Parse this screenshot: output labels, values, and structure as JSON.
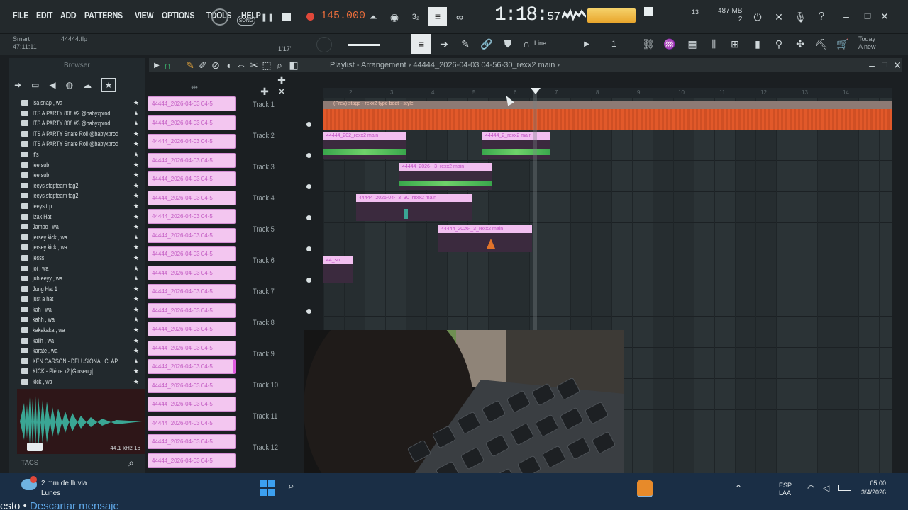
{
  "menu": [
    "FILE",
    "EDIT",
    "ADD",
    "PATTERNS",
    "VIEW",
    "OPTIONS",
    "TOOLS",
    "HELP"
  ],
  "hint": {
    "line1": "Smart",
    "line2": "47:11:11",
    "file": "44444.flp"
  },
  "transport": {
    "tempo": "145.000",
    "song_time_main": "1:18:",
    "song_time_sub": "57"
  },
  "stats": {
    "mem_top": "487 MB",
    "mem_bottom": "2",
    "cpu": "13"
  },
  "toolbar2": {
    "pattern": "1'17'",
    "snap": "Line",
    "number": "1"
  },
  "today": {
    "line1": "Today",
    "line2": "A new"
  },
  "browser": {
    "title": "Browser",
    "files": [
      "isa snap , wa",
      "ITS A PARTY 808 #2 @babyxprod",
      "ITS A PARTY 808 #3 @babyxprod",
      "ITS A PARTY Snare Roll @babyxprod",
      "ITS A PARTY Snare Roll @babyxprod",
      "it's",
      "iee sub",
      "iee sub",
      "ieeys stepteam tag2",
      "ieeys stepteam tag2",
      "ieeys trp",
      "Izak Hat",
      "Jambo , wa",
      "jersey kick , wa",
      "jersey kick , wa",
      "jesss",
      "joi , wa",
      "juh eeyy , wa",
      "Jung Hat 1",
      "just a hat",
      "kah , wa",
      "kahh , wa",
      "kakakaka , wa",
      "kalih , wa",
      "karate , wa",
      "KEN CARSON - DELUSIONAL CLAP",
      "KICK - Plérre x2 [Ginseng]",
      "kick , wa"
    ],
    "sample_rate": "44.1 kHz 16",
    "tags": "TAGS"
  },
  "clips": [
    "44444_2026-04-03 04-5",
    "44444_2026-04-03 04-5",
    "44444_2026-04-03 04-5",
    "44444_2026-04-03 04-5",
    "44444_2026-04-03 04-5",
    "44444_2026-04-03 04-5",
    "44444_2026-04-03 04-5",
    "44444_2026-04-03 04-5",
    "44444_2026-04-03 04-5",
    "44444_2026-04-03 04-5",
    "44444_2026-04-03 04-5",
    "44444_2026-04-03 04-5",
    "44444_2026-04-03 04-5",
    "44444_2026-04-03 04-5",
    "44444_2026-04-03 04-5",
    "44444_2026-04-03 04-5",
    "44444_2026-04-03 04-5",
    "44444_2026-04-03 04-5",
    "44444_2026-04-03 04-5",
    "44444_2026-04-03 04-5"
  ],
  "playlist": {
    "title": "Playlist - Arrangement › 44444_2026-04-03 04-56-30_rexx2 main ›",
    "tracks": [
      "Track 1",
      "Track 2",
      "Track 3",
      "Track 4",
      "Track 5",
      "Track 6",
      "Track 7",
      "Track 8",
      "Track 9",
      "Track 10",
      "Track 11",
      "Track 12"
    ],
    "ruler": [
      "2",
      "3",
      "4",
      "5",
      "6",
      "7",
      "8",
      "9",
      "10",
      "11",
      "12",
      "13",
      "14"
    ],
    "track1_label": "(Prev) stage - rexx2 type beat - style",
    "clip_labels": {
      "t2a": "44444_202_rexx2 main",
      "t2b": "44444_2_rexx2 main",
      "t3": "44444_2026-_3_rexx2 main",
      "t4": "44444_2026-04-_3_30_rexx2 main",
      "t5": "44444_2026-_3_rexx2 main",
      "t6": "44_sn"
    }
  },
  "taskbar": {
    "weather_line1": "2 mm de lluvia",
    "weather_line2": "Lunes",
    "lang_line1": "ESP",
    "lang_line2": "LAA",
    "time": "05:00",
    "date": "3/4/2026"
  },
  "caption": {
    "prefix": "esto • ",
    "dismiss": "Descartar mensaje"
  },
  "colors": {
    "accent_orange": "#e2592a",
    "clip_pink": "#f2bff0",
    "audio_green": "#3aa64c",
    "meter_yellow": "#f5d16a"
  }
}
